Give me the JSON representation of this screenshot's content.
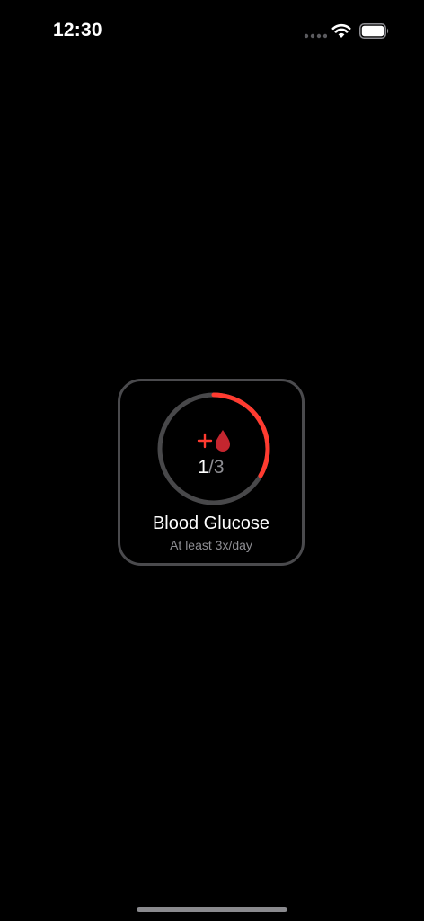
{
  "status_bar": {
    "time": "12:30",
    "icons": [
      "cellular-signal-icon",
      "wifi-icon",
      "battery-icon"
    ]
  },
  "widget": {
    "icon": "plus-blood-drop-icon",
    "count_current": "1",
    "count_separator": "/",
    "count_target": "3",
    "progress": 0.333,
    "title": "Blood Glucose",
    "subtitle": "At least 3x/day"
  },
  "colors": {
    "background": "#000000",
    "accent": "#ff3b30",
    "ring_track": "#48484a",
    "card_border": "#4a4a4d",
    "secondary_text": "#8e8e93"
  }
}
